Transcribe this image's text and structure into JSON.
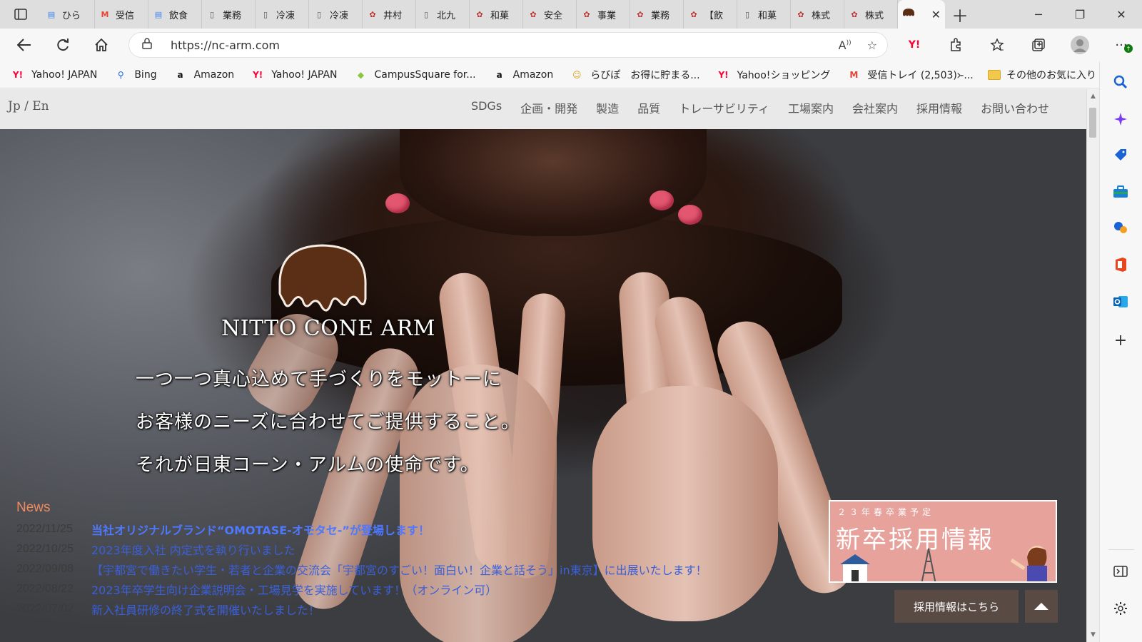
{
  "browser": {
    "tabs": [
      {
        "label": "ひら",
        "icon": "docs-icon"
      },
      {
        "label": "受信",
        "icon": "gmail-icon"
      },
      {
        "label": "飲食",
        "icon": "docs-icon"
      },
      {
        "label": "業務",
        "icon": "page-icon"
      },
      {
        "label": "冷凍",
        "icon": "page-icon"
      },
      {
        "label": "冷凍",
        "icon": "page-icon"
      },
      {
        "label": "井村",
        "icon": "site-logo-icon"
      },
      {
        "label": "北九",
        "icon": "page-icon"
      },
      {
        "label": "和菓",
        "icon": "site-logo-icon"
      },
      {
        "label": "安全",
        "icon": "site-logo-icon"
      },
      {
        "label": "事業",
        "icon": "site-logo-icon"
      },
      {
        "label": "業務",
        "icon": "site-logo-icon"
      },
      {
        "label": "【飲",
        "icon": "site-logo-icon"
      },
      {
        "label": "和菓",
        "icon": "page-icon"
      },
      {
        "label": "株式",
        "icon": "site-logo-icon"
      },
      {
        "label": "株式",
        "icon": "site-logo-icon"
      }
    ],
    "url": "https://nc-arm.com",
    "bookmarks": [
      {
        "label": "Yahoo! JAPAN",
        "icon": "yahoo-icon"
      },
      {
        "label": "Bing",
        "icon": "bing-search-icon"
      },
      {
        "label": "Amazon",
        "icon": "amazon-icon"
      },
      {
        "label": "Yahoo! JAPAN",
        "icon": "yahoo-icon"
      },
      {
        "label": "CampusSquare for...",
        "icon": "campus-icon"
      },
      {
        "label": "Amazon",
        "icon": "amazon-icon"
      },
      {
        "label": "らびぽ　お得に貯まる...",
        "icon": "rabipo-icon"
      },
      {
        "label": "Yahoo!ショッピング",
        "icon": "yahoo-icon"
      },
      {
        "label": "受信トレイ (2,503) -...",
        "icon": "gmail-icon"
      }
    ],
    "other_favorites": "その他のお気に入り"
  },
  "site": {
    "lang_switch": "Jp / En",
    "nav": [
      "SDGs",
      "企画・開発",
      "製造",
      "品質",
      "トレーサビリティ",
      "工場案内",
      "会社案内",
      "採用情報",
      "お問い合わせ"
    ],
    "logo_text": "NITTO CONE ARM",
    "tagline": [
      "一つ一つ真心込めて手づくりをモットーに",
      "お客様のニーズに合わせてご提供すること。",
      "それが日東コーン・アルムの使命です。"
    ],
    "news_title": "News",
    "news": [
      {
        "date": "2022/11/25",
        "text": "当社オリジナルブランド“OMOTASE-オモタセ-”が登場します！"
      },
      {
        "date": "2022/10/25",
        "text": "2023年度入社 内定式を執り行いました"
      },
      {
        "date": "2022/09/08",
        "text": "【宇都宮で働きたい学生・若者と企業の交流会「宇都宮のすごい！面白い！企業と話そう」in東京】に出展いたします！"
      },
      {
        "date": "2022/08/22",
        "text": "2023年卒学生向け企業説明会・工場見学を実施しています！（オンライン可）"
      },
      {
        "date": "2022/07/02",
        "text": "新入社員研修の終了式を開催いたしました！"
      }
    ],
    "recruit_banner": {
      "sub": "２３年春卒業予定",
      "main": "新卒採用情報"
    },
    "recruit_button": "採用情報はこちら",
    "colors": {
      "accent_news": "#f08a5d",
      "link": "#3a5fd9",
      "logo_brown": "#5b2f16",
      "button_bg": "#5a4a44",
      "banner_pink": "#e8a29c"
    }
  }
}
